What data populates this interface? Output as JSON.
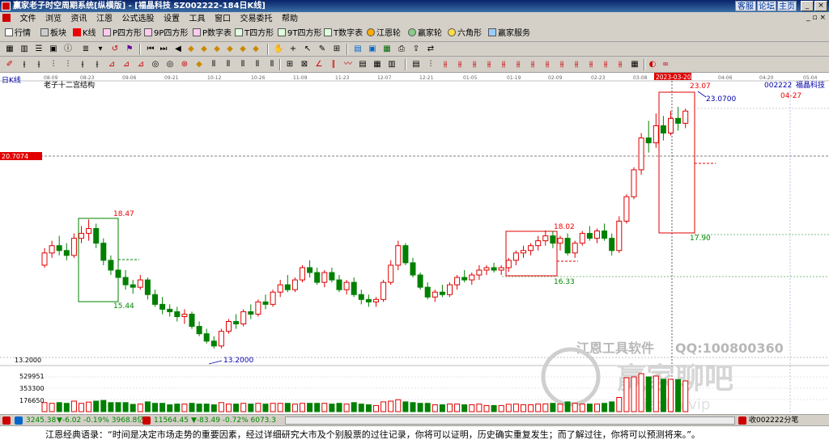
{
  "window": {
    "title": "赢家老子时空周期系统[纵横版] - [福晶科技  SZ002222-184日K线]",
    "links": [
      "客服",
      "论坛",
      "主页"
    ]
  },
  "menu": [
    "文件",
    "浏览",
    "资讯",
    "江恩",
    "公式选股",
    "设置",
    "工具",
    "窗口",
    "交易委托",
    "帮助"
  ],
  "toolbar1": [
    "行情",
    "板块",
    "K线",
    "P四方形",
    "9P四方形",
    "P数字表",
    "T四方形",
    "9T四方形",
    "T数字表",
    "江恩轮",
    "赢家轮",
    "六角形",
    "赢家服务"
  ],
  "chart": {
    "period_label": "日K线",
    "indicator_name": "老子十二宫结构",
    "stock_code": "002222",
    "stock_name": "福晶科技",
    "date_ticks": [
      "08-09",
      "08-23",
      "09-06",
      "09-21",
      "10-12",
      "10-26",
      "11-09",
      "11-23",
      "12-07",
      "12-21",
      "01-05",
      "01-19",
      "02-09",
      "02-23",
      "03-08",
      "2023-03-20",
      "04-06",
      "04-20",
      "05-04"
    ],
    "cursor_date": "2023-03-20",
    "price_tag": "20.7074",
    "right_date": "04-27",
    "low_label": "13.2000",
    "low_axis": "13.2000",
    "vol_axis": [
      "529951",
      "353300",
      "176650"
    ],
    "boxes": {
      "box1_high": "18.47",
      "box1_low": "15.44",
      "box2_high": "18.02",
      "box2_low": "16.33",
      "box3_high": "23.07",
      "box3_low": "17.90",
      "peak_value": "23.0700"
    },
    "watermark": [
      "江恩工具软件",
      "QQ:100800360",
      "赢家聊吧",
      "iiaoba.vip"
    ],
    "colors": {
      "up": "#e00000",
      "down": "#008000",
      "box": "#e00000",
      "green_box": "#008000"
    }
  },
  "footer": {
    "index1": "3245.38",
    "index1_change": "▼-6.02 -0.19% 3968.8亿",
    "index2": "11564.45",
    "index2_change": "▼-83.49 -0.72% 6073.3",
    "right_status": "收002222分笔"
  },
  "quote": "江恩经典语录：“时间是决定市场走势的重要因素，经过详细研究大市及个别股票的过往记录，你将可以证明，历史确实重复发生；而了解过往，你将可以预测将来。”。",
  "chart_data": {
    "type": "candlestick",
    "title": "老子十二宫结构",
    "y_axis": {
      "labels": [
        "13.2000"
      ],
      "range": [
        12.5,
        24.0
      ]
    },
    "series": [
      {
        "name": "002222",
        "ohlc": [
          [
            16.6,
            17.3,
            16.5,
            17.1
          ],
          [
            17.1,
            17.6,
            16.9,
            17.4
          ],
          [
            17.4,
            17.8,
            17.0,
            17.2
          ],
          [
            17.2,
            17.5,
            16.8,
            17.0
          ],
          [
            17.0,
            17.9,
            16.9,
            17.7
          ],
          [
            17.7,
            18.2,
            17.5,
            17.9
          ],
          [
            17.9,
            18.47,
            17.6,
            18.1
          ],
          [
            18.1,
            18.3,
            17.3,
            17.5
          ],
          [
            17.5,
            17.7,
            16.6,
            16.8
          ],
          [
            16.8,
            17.0,
            16.2,
            16.4
          ],
          [
            16.4,
            16.7,
            15.9,
            16.1
          ],
          [
            16.1,
            16.4,
            15.6,
            15.8
          ],
          [
            15.8,
            16.0,
            15.44,
            15.7
          ],
          [
            15.7,
            16.2,
            15.6,
            16.0
          ],
          [
            16.0,
            16.1,
            15.2,
            15.4
          ],
          [
            15.4,
            15.6,
            14.9,
            15.0
          ],
          [
            15.0,
            15.3,
            14.6,
            14.8
          ],
          [
            14.8,
            15.0,
            14.5,
            14.7
          ],
          [
            14.7,
            14.9,
            14.3,
            14.5
          ],
          [
            14.5,
            14.8,
            14.2,
            14.6
          ],
          [
            14.6,
            14.7,
            14.0,
            14.1
          ],
          [
            14.1,
            14.3,
            13.7,
            13.8
          ],
          [
            13.8,
            14.0,
            13.4,
            13.5
          ],
          [
            13.5,
            13.7,
            13.2,
            13.3
          ],
          [
            13.3,
            14.0,
            13.2,
            13.9
          ],
          [
            13.9,
            14.4,
            13.8,
            14.3
          ],
          [
            14.3,
            14.6,
            14.0,
            14.2
          ],
          [
            14.2,
            14.8,
            14.1,
            14.7
          ],
          [
            14.7,
            15.0,
            14.4,
            14.6
          ],
          [
            14.6,
            15.2,
            14.5,
            15.1
          ],
          [
            15.1,
            15.4,
            14.8,
            15.0
          ],
          [
            15.0,
            15.6,
            14.9,
            15.5
          ],
          [
            15.5,
            16.0,
            15.3,
            15.8
          ],
          [
            15.8,
            16.2,
            15.5,
            15.6
          ],
          [
            15.6,
            16.1,
            15.5,
            16.0
          ],
          [
            16.0,
            16.6,
            15.9,
            16.5
          ],
          [
            16.5,
            16.8,
            16.1,
            16.3
          ],
          [
            16.3,
            16.5,
            15.8,
            15.9
          ],
          [
            15.9,
            16.4,
            15.7,
            16.3
          ],
          [
            16.3,
            16.5,
            15.9,
            16.0
          ],
          [
            16.0,
            16.2,
            15.5,
            15.6
          ],
          [
            15.6,
            16.0,
            15.4,
            15.9
          ],
          [
            15.9,
            16.1,
            15.3,
            15.4
          ],
          [
            15.4,
            15.6,
            15.0,
            15.2
          ],
          [
            15.2,
            15.4,
            14.9,
            15.1
          ],
          [
            15.1,
            15.3,
            14.9,
            15.2
          ],
          [
            15.2,
            16.0,
            15.1,
            15.9
          ],
          [
            15.9,
            16.8,
            15.8,
            16.6
          ],
          [
            16.6,
            17.6,
            16.4,
            17.4
          ],
          [
            17.4,
            17.5,
            16.6,
            16.7
          ],
          [
            16.7,
            16.9,
            16.1,
            16.2
          ],
          [
            16.2,
            16.3,
            15.6,
            15.7
          ],
          [
            15.7,
            15.9,
            15.2,
            15.3
          ],
          [
            15.3,
            15.6,
            15.1,
            15.5
          ],
          [
            15.5,
            15.8,
            15.3,
            15.4
          ],
          [
            15.4,
            15.9,
            15.3,
            15.8
          ],
          [
            15.8,
            16.2,
            15.6,
            16.1
          ],
          [
            16.1,
            16.4,
            15.9,
            16.0
          ],
          [
            16.0,
            16.3,
            15.8,
            16.2
          ],
          [
            16.2,
            16.6,
            16.0,
            16.4
          ],
          [
            16.4,
            16.6,
            16.2,
            16.5
          ],
          [
            16.5,
            16.7,
            16.3,
            16.4
          ],
          [
            16.4,
            16.6,
            16.2,
            16.5
          ],
          [
            16.5,
            16.9,
            16.33,
            16.8
          ],
          [
            16.8,
            17.2,
            16.6,
            17.1
          ],
          [
            17.1,
            17.4,
            16.9,
            17.2
          ],
          [
            17.2,
            17.5,
            17.0,
            17.4
          ],
          [
            17.4,
            17.8,
            17.2,
            17.6
          ],
          [
            17.6,
            18.02,
            17.4,
            17.8
          ],
          [
            17.8,
            18.0,
            17.3,
            17.5
          ],
          [
            17.5,
            17.8,
            17.2,
            17.7
          ],
          [
            17.7,
            17.9,
            17.0,
            17.1
          ],
          [
            17.1,
            17.6,
            16.9,
            17.5
          ],
          [
            17.5,
            18.0,
            17.4,
            17.9
          ],
          [
            17.9,
            18.2,
            17.6,
            17.7
          ],
          [
            17.7,
            18.1,
            17.5,
            18.0
          ],
          [
            18.0,
            18.3,
            17.6,
            17.7
          ],
          [
            17.7,
            17.9,
            17.0,
            17.2
          ],
          [
            17.2,
            18.6,
            17.1,
            18.4
          ],
          [
            18.4,
            19.5,
            18.3,
            19.4
          ],
          [
            19.4,
            20.6,
            19.3,
            20.5
          ],
          [
            20.5,
            22.0,
            20.3,
            21.8
          ],
          [
            21.8,
            22.5,
            21.2,
            21.6
          ],
          [
            21.6,
            22.8,
            21.4,
            22.3
          ],
          [
            22.3,
            22.7,
            21.7,
            22.0
          ],
          [
            22.0,
            22.9,
            21.9,
            22.6
          ],
          [
            22.6,
            23.07,
            22.1,
            22.4
          ],
          [
            22.4,
            23.0,
            22.2,
            22.9
          ]
        ]
      }
    ]
  }
}
